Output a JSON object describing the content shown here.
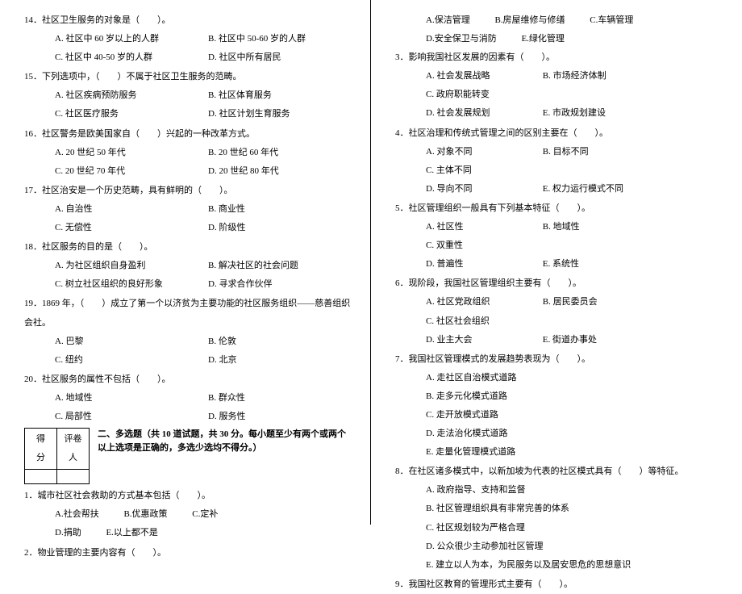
{
  "left": {
    "q14": {
      "stem": "14．社区卫生服务的对象是（　　）。",
      "a": "A. 社区中 60 岁以上的人群",
      "b": "B. 社区中 50-60 岁的人群",
      "c": "C. 社区中 40-50 岁的人群",
      "d": "D. 社区中所有居民"
    },
    "q15": {
      "stem": "15．下列选项中，（　　）不属于社区卫生服务的范畴。",
      "a": "A. 社区疾病预防服务",
      "b": "B. 社区体育服务",
      "c": "C. 社区医疗服务",
      "d": "D. 社区计划生育服务"
    },
    "q16": {
      "stem": "16．社区警务是欧美国家自（　　）兴起的一种改革方式。",
      "a": "A. 20 世纪 50 年代",
      "b": "B. 20 世纪 60 年代",
      "c": "C. 20 世纪 70 年代",
      "d": "D. 20 世纪 80 年代"
    },
    "q17": {
      "stem": "17．社区治安是一个历史范畴，具有鲜明的（　　）。",
      "a": "A. 自治性",
      "b": "B. 商业性",
      "c": "C. 无偿性",
      "d": "D. 阶级性"
    },
    "q18": {
      "stem": "18．社区服务的目的是（　　）。",
      "a": "A. 为社区组织自身盈利",
      "b": "B. 解决社区的社会问题",
      "c": "C. 树立社区组织的良好形象",
      "d": "D. 寻求合作伙伴"
    },
    "q19": {
      "stem": "19．1869 年，（　　）成立了第一个以济贫为主要功能的社区服务组织——慈善组织会社。",
      "a": "A. 巴黎",
      "b": "B. 伦敦",
      "c": "C. 纽约",
      "d": "D. 北京"
    },
    "q20": {
      "stem": "20．社区服务的属性不包括（　　）。",
      "a": "A. 地域性",
      "b": "B. 群众性",
      "c": "C. 局部性",
      "d": "D. 服务性"
    },
    "score": {
      "c1": "得 分",
      "c2": "评卷人"
    },
    "section2": "二、多选题（共 10 道试题，共 30 分。每小题至少有两个或两个以上选项是正确的，多选少选均不得分。）",
    "m1": {
      "stem": "1．城市社区社会救助的方式基本包括（　　）。",
      "a": "A.社会帮扶",
      "b": "B.优惠政策",
      "c": "C.定补",
      "d": "D.捐助",
      "e": "E.以上都不是"
    },
    "m2": {
      "stem": "2．物业管理的主要内容有（　　）。"
    }
  },
  "right": {
    "m2opts": {
      "a": "A.保洁管理",
      "b": "B.房屋维修与修缮",
      "c": "C.车辆管理",
      "d": "D.安全保卫与消防",
      "e": "E.绿化管理"
    },
    "m3": {
      "stem": "3．影响我国社区发展的因素有（　　）。",
      "a": "A. 社会发展战略",
      "b": "B. 市场经济体制",
      "c": "C. 政府职能转变",
      "d": "D. 社会发展规划",
      "e": "E. 市政规划建设"
    },
    "m4": {
      "stem": "4．社区治理和传统式管理之间的区别主要在（　　）。",
      "a": "A. 对象不同",
      "b": "B. 目标不同",
      "c": "C. 主体不同",
      "d": "D. 导向不同",
      "e": "E. 权力运行模式不同"
    },
    "m5": {
      "stem": "5．社区管理组织一般具有下列基本特征（　　）。",
      "a": "A. 社区性",
      "b": "B. 地域性",
      "c": "C. 双重性",
      "d": "D. 普遍性",
      "e": "E. 系统性"
    },
    "m6": {
      "stem": "6．现阶段，我国社区管理组织主要有（　　）。",
      "a": "A. 社区党政组织",
      "b": "B. 居民委员会",
      "c": "C. 社区社会组织",
      "d": "D. 业主大会",
      "e": "E. 街道办事处"
    },
    "m7": {
      "stem": "7．我国社区管理模式的发展趋势表现为（　　）。",
      "a": "A. 走社区自治模式道路",
      "b": "B. 走多元化模式道路",
      "c": "C. 走开放模式道路",
      "d": "D. 走法治化模式道路",
      "e": "E. 走量化管理模式道路"
    },
    "m8": {
      "stem": "8．在社区诸多模式中，以新加坡为代表的社区模式具有（　　）等特征。",
      "a": "A. 政府指导、支持和监督",
      "b": "B. 社区管理组织具有非常完善的体系",
      "c": "C. 社区规划较为严格合理",
      "d": "D. 公众很少主动参加社区管理",
      "e": "E. 建立以人为本，为民服务以及居安思危的思想意识"
    },
    "m9": {
      "stem": "9．我国社区教育的管理形式主要有（　　）。"
    }
  }
}
